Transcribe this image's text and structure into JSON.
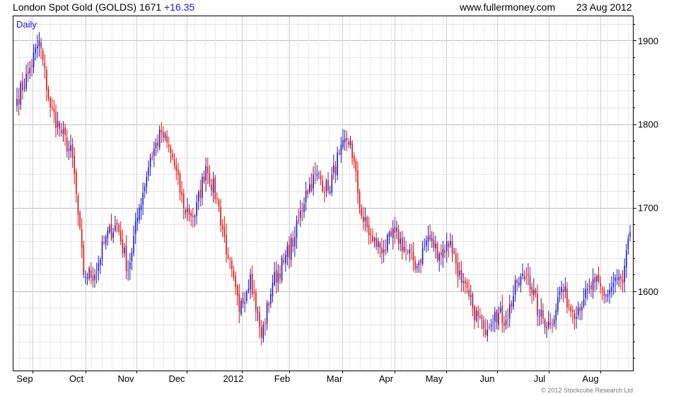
{
  "header": {
    "title": "London Spot Gold (GOLDS)",
    "price": "1671",
    "change": "+16.35",
    "site": "www.fullermoney.com",
    "date": "23 Aug 2012"
  },
  "credit": "© 2012 Stockcube Research Ltd",
  "colors": {
    "up": "#1a1acc",
    "down": "#e01010",
    "grid": "#d8d8d8",
    "axis": "#000000"
  },
  "chart_data": {
    "type": "candlestick",
    "mode_label": "Daily",
    "x_labels": [
      "Sep",
      "Oct",
      "Nov",
      "Dec",
      "2012",
      "Feb",
      "Mar",
      "Apr",
      "May",
      "Jun",
      "Jul",
      "Aug"
    ],
    "y_ticks": [
      1600,
      1700,
      1800,
      1900
    ],
    "ylim": [
      1505,
      1930
    ],
    "y_axis_side": "right",
    "grid": true,
    "close_anchors": [
      [
        0,
        1830
      ],
      [
        6,
        1860
      ],
      [
        12,
        1900
      ],
      [
        18,
        1820
      ],
      [
        24,
        1790
      ],
      [
        30,
        1760
      ],
      [
        36,
        1620
      ],
      [
        42,
        1620
      ],
      [
        48,
        1665
      ],
      [
        54,
        1680
      ],
      [
        60,
        1625
      ],
      [
        66,
        1700
      ],
      [
        72,
        1760
      ],
      [
        78,
        1790
      ],
      [
        84,
        1760
      ],
      [
        90,
        1700
      ],
      [
        96,
        1690
      ],
      [
        102,
        1750
      ],
      [
        108,
        1710
      ],
      [
        114,
        1640
      ],
      [
        120,
        1575
      ],
      [
        126,
        1620
      ],
      [
        132,
        1545
      ],
      [
        138,
        1610
      ],
      [
        144,
        1635
      ],
      [
        150,
        1665
      ],
      [
        156,
        1720
      ],
      [
        162,
        1740
      ],
      [
        168,
        1720
      ],
      [
        174,
        1765
      ],
      [
        180,
        1780
      ],
      [
        186,
        1690
      ],
      [
        192,
        1660
      ],
      [
        198,
        1650
      ],
      [
        204,
        1670
      ],
      [
        210,
        1650
      ],
      [
        216,
        1630
      ],
      [
        222,
        1665
      ],
      [
        228,
        1645
      ],
      [
        234,
        1660
      ],
      [
        240,
        1610
      ],
      [
        246,
        1580
      ],
      [
        252,
        1555
      ],
      [
        258,
        1575
      ],
      [
        264,
        1565
      ],
      [
        270,
        1610
      ],
      [
        276,
        1620
      ],
      [
        282,
        1570
      ],
      [
        288,
        1560
      ],
      [
        294,
        1605
      ],
      [
        300,
        1575
      ],
      [
        306,
        1590
      ],
      [
        312,
        1610
      ],
      [
        318,
        1595
      ],
      [
        324,
        1615
      ],
      [
        327,
        1610
      ],
      [
        331,
        1671
      ]
    ]
  }
}
